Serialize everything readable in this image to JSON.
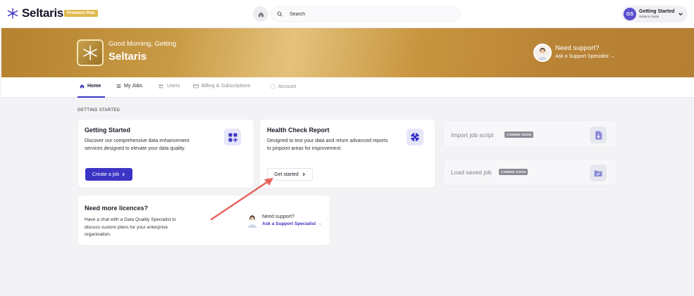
{
  "header": {
    "brand": "Seltaris",
    "plan_badge": "Premium Plan",
    "search_placeholder": "Search",
    "user": {
      "initials": "GS",
      "name": "Getting Started",
      "role": "Seltaris Guide"
    }
  },
  "banner": {
    "greeting": "Good Morning, Getting",
    "company": "Seltaris",
    "support_title": "Need support?",
    "support_link": "Ask a Support Specialist →"
  },
  "tabs": [
    {
      "label": "Home",
      "icon": "home-icon",
      "active": true
    },
    {
      "label": "My Jobs",
      "icon": "list-icon",
      "active": false
    },
    {
      "label": "Users",
      "icon": "users-icon",
      "active": false
    },
    {
      "label": "Billing & Subscriptions",
      "icon": "wallet-icon",
      "active": false
    },
    {
      "label": "Account",
      "icon": "account-icon",
      "active": false
    }
  ],
  "section_label": "GETTING STARTED",
  "cards": {
    "getting_started": {
      "title": "Getting Started",
      "description_lines": [
        "Discover our comprehensive data enhancement",
        "services designed to elevate your data quality."
      ],
      "button": "Create a job"
    },
    "health_check": {
      "title": "Health Check Report",
      "description_lines": [
        "Designed to test your data and return advanced reports",
        "to pinpoint areas for improvement."
      ],
      "button": "Get started"
    },
    "import_job": {
      "title": "Import job script",
      "badge": "COMING SOON"
    },
    "load_job": {
      "title": "Load saved job",
      "badge": "COMING SOON"
    },
    "licences": {
      "title": "Need more licences?",
      "description_lines": [
        "Have a chat with a Data Quality Specialist to",
        "discuss custom plans for your enterprise",
        "organisation."
      ],
      "support_title": "Need support?",
      "support_link": "Ask a Support Specialist →"
    }
  },
  "colors": {
    "accent": "#3b34c4",
    "banner_gold": "#c2903c",
    "annotation_arrow": "#e8615a"
  }
}
